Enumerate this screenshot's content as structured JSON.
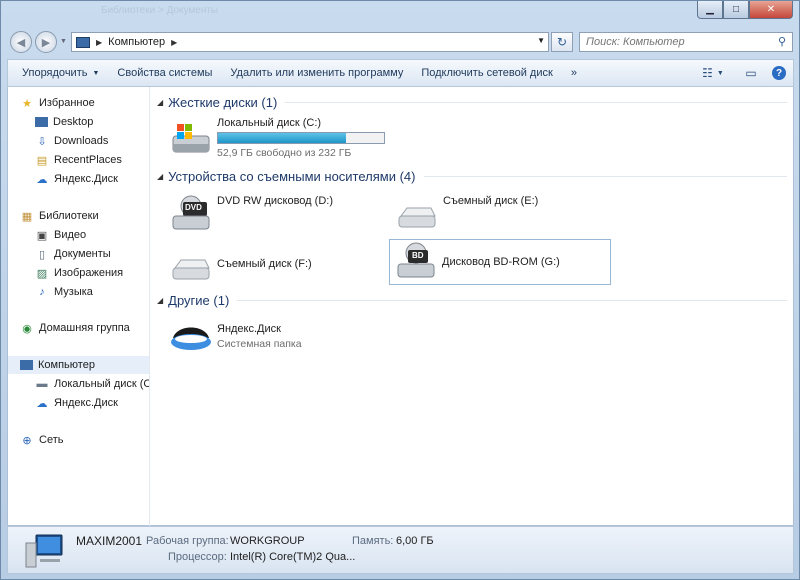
{
  "window": {
    "title_ghost": "Библиотеки > Документы"
  },
  "nav": {
    "address": "Компьютер",
    "search_placeholder": "Поиск: Компьютер"
  },
  "toolbar": {
    "organize": "Упорядочить",
    "system_properties": "Свойства системы",
    "uninstall": "Удалить или изменить программу",
    "map_drive": "Подключить сетевой диск",
    "more": "»"
  },
  "sidebar": {
    "favorites": "Избранное",
    "desktop": "Desktop",
    "downloads": "Downloads",
    "recent": "RecentPlaces",
    "yadisk_fav": "Яндекс.Диск",
    "libraries": "Библиотеки",
    "video": "Видео",
    "documents": "Документы",
    "images": "Изображения",
    "music": "Музыка",
    "homegroup": "Домашняя группа",
    "computer": "Компьютер",
    "local_c": "Локальный диск (C",
    "yadisk_pc": "Яндекс.Диск",
    "network": "Сеть"
  },
  "groups": {
    "hdd": "Жесткие диски (1)",
    "removable": "Устройства со съемными носителями (4)",
    "other": "Другие (1)"
  },
  "drives": {
    "c_name": "Локальный диск (C:)",
    "c_free": "52,9 ГБ свободно из 232 ГБ",
    "c_used_fraction": 0.77,
    "dvd": "DVD RW дисковод (D:)",
    "dvd_badge": "DVD",
    "e": "Съемный диск (E:)",
    "f": "Съемный диск (F:)",
    "bd": "Дисковод BD-ROM (G:)",
    "bd_badge": "BD"
  },
  "other": {
    "yadisk_name": "Яндекс.Диск",
    "yadisk_sub": "Системная папка"
  },
  "status": {
    "pc_name": "MAXIM2001",
    "workgroup_label": "Рабочая группа:",
    "workgroup_value": "WORKGROUP",
    "memory_label": "Память:",
    "memory_value": "6,00 ГБ",
    "cpu_label": "Процессор:",
    "cpu_value": "Intel(R) Core(TM)2 Qua..."
  }
}
